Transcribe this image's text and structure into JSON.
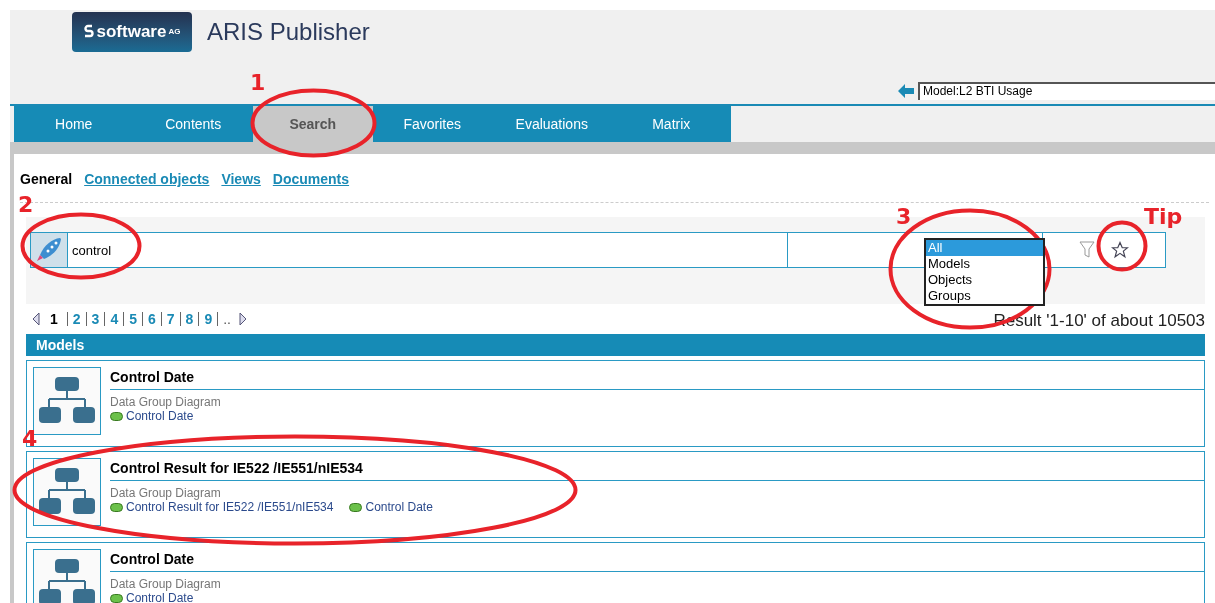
{
  "header": {
    "logo": "software",
    "logo_suffix": "AG",
    "title": "ARIS Publisher",
    "breadcrumb": "Model:L2 BTI Usage"
  },
  "nav": [
    {
      "label": "Home",
      "selected": false
    },
    {
      "label": "Contents",
      "selected": false
    },
    {
      "label": "Search",
      "selected": true
    },
    {
      "label": "Favorites",
      "selected": false
    },
    {
      "label": "Evaluations",
      "selected": false
    },
    {
      "label": "Matrix",
      "selected": false
    }
  ],
  "subtabs": [
    {
      "label": "General",
      "selected": true
    },
    {
      "label": "Connected objects",
      "selected": false
    },
    {
      "label": "Views",
      "selected": false
    },
    {
      "label": "Documents",
      "selected": false
    }
  ],
  "search": {
    "value": "control",
    "scope_options": [
      {
        "label": "All",
        "selected": true
      },
      {
        "label": "Models",
        "selected": false
      },
      {
        "label": "Objects",
        "selected": false
      },
      {
        "label": "Groups",
        "selected": false
      }
    ]
  },
  "pagination": {
    "pages": [
      {
        "label": "1",
        "selected": true
      },
      {
        "label": "2",
        "selected": false
      },
      {
        "label": "3",
        "selected": false
      },
      {
        "label": "4",
        "selected": false
      },
      {
        "label": "5",
        "selected": false
      },
      {
        "label": "6",
        "selected": false
      },
      {
        "label": "7",
        "selected": false
      },
      {
        "label": "8",
        "selected": false
      },
      {
        "label": "9",
        "selected": false
      }
    ],
    "more": "..",
    "result": "Result '1-10' of about 10503"
  },
  "section": {
    "title": "Models"
  },
  "results": [
    {
      "title": "Control Date",
      "type": "Data Group Diagram",
      "links": [
        "Control Date"
      ]
    },
    {
      "title": "Control Result for IE522 /IE551/nIE534",
      "type": "Data Group Diagram",
      "links": [
        "Control Result for IE522 /IE551/nIE534",
        "Control Date"
      ]
    },
    {
      "title": "Control Date",
      "type": "Data Group Diagram",
      "links": [
        "Control Date"
      ]
    }
  ],
  "annotations": [
    {
      "label": "1",
      "kind": "ellipse"
    },
    {
      "label": "2",
      "kind": "ellipse"
    },
    {
      "label": "3",
      "kind": "ellipse"
    },
    {
      "label": "Tip",
      "kind": "circle"
    },
    {
      "label": "4",
      "kind": "ellipse"
    }
  ]
}
